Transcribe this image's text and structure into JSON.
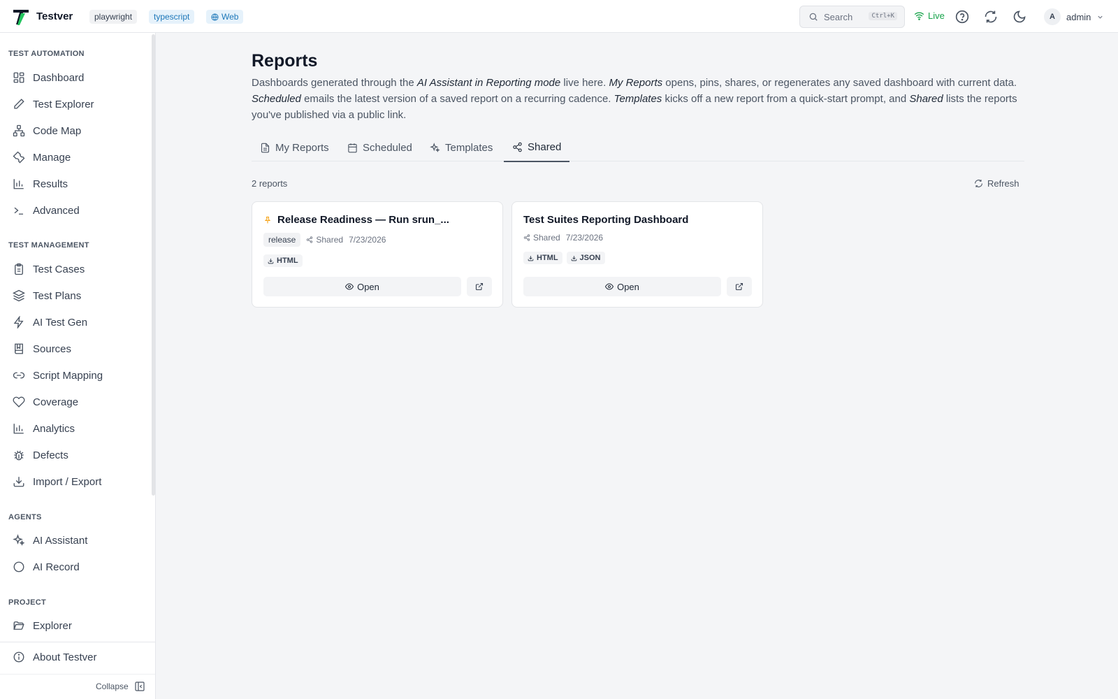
{
  "header": {
    "app_name": "Testver",
    "chips": [
      "playwright",
      "typescript",
      "Web"
    ],
    "search_label": "Search",
    "search_shortcut": "Ctrl+K",
    "live_label": "Live",
    "avatar_letter": "A",
    "user_name": "admin"
  },
  "sidebar": {
    "sections": [
      {
        "title": "TEST AUTOMATION",
        "items": [
          "Dashboard",
          "Test Explorer",
          "Code Map",
          "Manage",
          "Results",
          "Advanced"
        ]
      },
      {
        "title": "TEST MANAGEMENT",
        "items": [
          "Test Cases",
          "Test Plans",
          "AI Test Gen",
          "Sources",
          "Script Mapping",
          "Coverage",
          "Analytics",
          "Defects",
          "Import / Export"
        ]
      },
      {
        "title": "AGENTS",
        "items": [
          "AI Assistant",
          "AI Record"
        ]
      },
      {
        "title": "PROJECT",
        "items": [
          "Explorer"
        ]
      }
    ],
    "about": "About Testver",
    "collapse": "Collapse"
  },
  "main": {
    "title": "Reports",
    "desc": {
      "p1": "Dashboards generated through the ",
      "e1": "AI Assistant in Reporting mode",
      "p2": " live here. ",
      "e2": "My Reports",
      "p3": " opens, pins, shares, or regenerates any saved dashboard with current data. ",
      "e3": "Scheduled",
      "p4": " emails the latest version of a saved report on a recurring cadence. ",
      "e4": "Templates",
      "p5": " kicks off a new report from a quick-start prompt, and ",
      "e5": "Shared",
      "p6": " lists the reports you've published via a public link."
    },
    "tabs": [
      "My Reports",
      "Scheduled",
      "Templates",
      "Shared"
    ],
    "active_tab": "Shared",
    "count_label": "2 reports",
    "refresh_label": "Refresh",
    "cards": [
      {
        "title": "Release Readiness — Run srun_...",
        "pinned": true,
        "tag": "release",
        "shared_label": "Shared",
        "date": "7/23/2026",
        "formats": [
          "HTML"
        ],
        "open_label": "Open"
      },
      {
        "title": "Test Suites Reporting Dashboard",
        "pinned": false,
        "shared_label": "Shared",
        "date": "7/23/2026",
        "formats": [
          "HTML",
          "JSON"
        ],
        "open_label": "Open"
      }
    ]
  },
  "colors": {
    "accent": "#16a34a",
    "chip_blue": "#1d77b9",
    "pin": "#f59e0b"
  }
}
